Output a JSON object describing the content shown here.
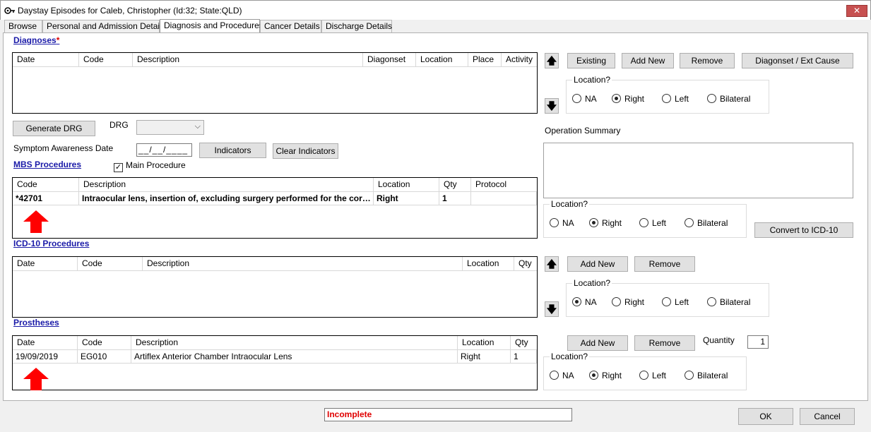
{
  "window": {
    "title": "Daystay Episodes for Caleb, Christopher (Id:32; State:QLD)",
    "close_glyph": "✕"
  },
  "tabs": [
    "Browse",
    "Personal and Admission Details",
    "Diagnosis and Procedures",
    "Cancer Details",
    "Discharge Details"
  ],
  "active_tab": "Diagnosis and Procedures",
  "diagnoses": {
    "label": "Diagnoses",
    "required_mark": "*",
    "columns": [
      "Date",
      "Code",
      "Description",
      "Diagonset",
      "Location",
      "Place",
      "Activity"
    ],
    "buttons": {
      "existing": "Existing",
      "add_new": "Add New",
      "remove": "Remove",
      "diagonset": "Diagonset / Ext Cause"
    },
    "location": {
      "title": "Location?",
      "options": [
        "NA",
        "Right",
        "Left",
        "Bilateral"
      ],
      "selected": "Right"
    }
  },
  "drg": {
    "generate_label": "Generate DRG",
    "label": "DRG",
    "symptom_label": "Symptom Awareness Date",
    "symptom_value": "__/__/____",
    "indicators_label": "Indicators",
    "clear_indicators_label": "Clear Indicators"
  },
  "operation_summary": {
    "label": "Operation Summary",
    "location": {
      "title": "Location?",
      "options": [
        "NA",
        "Right",
        "Left",
        "Bilateral"
      ],
      "selected": "Right"
    },
    "convert_label": "Convert to ICD-10"
  },
  "mbs": {
    "label": "MBS Procedures",
    "main_procedure_label": "Main Procedure",
    "main_procedure_checked": true,
    "columns": [
      "Code",
      "Description",
      "Location",
      "Qty",
      "Protocol"
    ],
    "rows": [
      {
        "code": "*42701",
        "description": "Intraocular lens, insertion of, excluding surgery performed for the correction of refractive error",
        "location": "Right",
        "qty": "1",
        "protocol": ""
      }
    ]
  },
  "icd10": {
    "label": "ICD-10 Procedures",
    "columns": [
      "Date",
      "Code",
      "Description",
      "Location",
      "Qty"
    ],
    "buttons": {
      "add_new": "Add New",
      "remove": "Remove"
    },
    "location": {
      "title": "Location?",
      "options": [
        "NA",
        "Right",
        "Left",
        "Bilateral"
      ],
      "selected": "NA"
    }
  },
  "prostheses": {
    "label": "Prostheses",
    "columns": [
      "Date",
      "Code",
      "Description",
      "Location",
      "Qty"
    ],
    "rows": [
      {
        "date": "19/09/2019",
        "code": "EG010",
        "description": "Artiflex Anterior Chamber Intraocular Lens",
        "location": "Right",
        "qty": "1"
      }
    ],
    "buttons": {
      "add_new": "Add New",
      "remove": "Remove"
    },
    "quantity_label": "Quantity",
    "quantity_value": "1",
    "location": {
      "title": "Location?",
      "options": [
        "NA",
        "Right",
        "Left",
        "Bilateral"
      ],
      "selected": "Right"
    }
  },
  "footer": {
    "status": "Incomplete",
    "ok": "OK",
    "cancel": "Cancel"
  },
  "colors": {
    "status_text": "#e00000",
    "link": "#1a1aa8",
    "annotation_arrow": "#ff0000"
  }
}
